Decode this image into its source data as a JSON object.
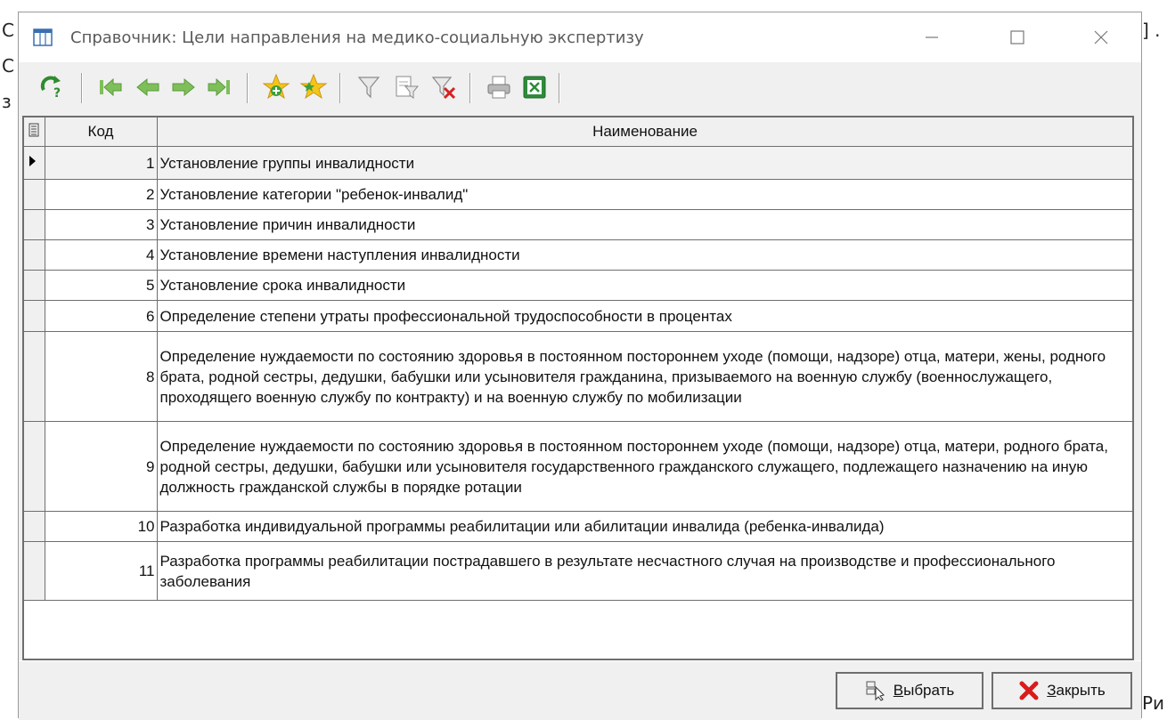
{
  "background": {
    "frag1": "С",
    "frag2": "С",
    "frag3": "з",
    "frag4": "] .",
    "frag5": "Ри"
  },
  "window": {
    "title": "Справочник: Цели направления на медико-социальную экспертизу"
  },
  "table": {
    "headers": {
      "code": "Код",
      "name": "Наименование"
    },
    "rows": [
      {
        "code": "1",
        "name": "Установление группы инвалидности"
      },
      {
        "code": "2",
        "name": "Установление категории \"ребенок-инвалид\""
      },
      {
        "code": "3",
        "name": "Установление причин инвалидности"
      },
      {
        "code": "4",
        "name": "Установление времени наступления инвалидности"
      },
      {
        "code": "5",
        "name": "Установление срока инвалидности"
      },
      {
        "code": "6",
        "name": "Определение степени утраты профессиональной трудоспособности в процентах"
      },
      {
        "code": "8",
        "name": "Определение нуждаемости по состоянию здоровья в постоянном постороннем уходе (помощи, надзоре) отца, матери, жены, родного брата, родной сестры, дедушки, бабушки или усыновителя гражданина, призываемого на военную службу (военнослужащего, проходящего военную службу по контракту) и на военную службу по мобилизации"
      },
      {
        "code": "9",
        "name": "Определение нуждаемости по состоянию здоровья в постоянном постороннем уходе (помощи, надзоре) отца, матери, родного брата, родной сестры, дедушки, бабушки или усыновителя государственного гражданского служащего, подлежащего назначению на иную должность гражданской службы в порядке ротации"
      },
      {
        "code": "10",
        "name": "Разработка индивидуальной программы реабилитации или абилитации инвалида (ребенка-инвалида)"
      },
      {
        "code": "11",
        "name": "Разработка программы реабилитации пострадавшего в результате несчастного случая на производстве и профессионального заболевания"
      }
    ]
  },
  "buttons": {
    "select": "Выбрать",
    "close": "Закрыть"
  }
}
